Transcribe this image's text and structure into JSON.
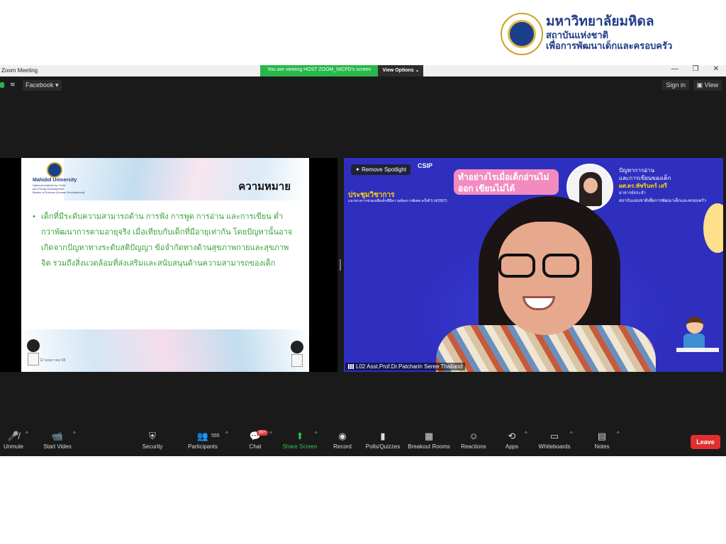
{
  "branding": {
    "org_name": "มหาวิทยาลัยมหิดล",
    "line2": "สถาบันแห่งชาติ",
    "line3": "เพื่อการพัฒนาเด็กและครอบครัว"
  },
  "window": {
    "title": "Zoom Meeting",
    "host_banner": "You are viewing HOST ZOOM_NICFD's screen",
    "view_options": "View Options",
    "controls": [
      "—",
      "❐",
      "✕"
    ]
  },
  "topbar": {
    "facebook_label": "Facebook",
    "signin_label": "Sign in",
    "view_label": "View"
  },
  "slide": {
    "university": "Mahidol University",
    "sub1": "National Institute for Child",
    "sub2": "and Family Development",
    "sub3": "Master of Science (Human Development)",
    "title": "ความหมาย",
    "bullet": "•",
    "body": "เด็กที่มีระดับความสามารถด้าน การฟัง การพูด การอ่าน และการเขียน ต่ำกว่าพัฒนาการตามอายุจริง เมื่อเทียบกับเด็กที่มีอายุเท่ากัน โดยปัญหานั้นอาจเกิดจากปัญหาทางระดับสติปัญญา ข้อจำกัดทางด้านสุขภาพกายและสุขภาพจิต รวมถึงสิ่งแวดล้อมที่ส่งเสริมและสนับสนุนด้านความสามารถของเด็ก",
    "footer": "12 พฤษภาคม 68"
  },
  "video": {
    "remove_spotlight": "Remove Spotlight",
    "csip": "CSIP",
    "conference_title": "ประชุมวิชาการ",
    "conference_sub": "แนวทางการช่วยเหลือเด็กที่มีความต้องการพิเศษ ครั้งที่ 5 (4/2567)",
    "headline": "ทำอย่างไรเมื่อเด็กอ่านไม่ออก เขียนไม่ได้",
    "right_title1": "ปัญหาการอ่าน",
    "right_title2": "และการเขียนของเด็ก",
    "speaker_name": "ผศ.ดร.พัชรินทร์ เสรี",
    "speaker_role": "อาจารย์ประจำ",
    "speaker_org": "สถาบันแห่งชาติเพื่อการพัฒนาเด็กและครอบครัว",
    "name_tag": "L02 Asst.Prof.Dr.Patcharin Seree Thailand"
  },
  "toolbar": {
    "unmute": "Unmute",
    "start_video": "Start Video",
    "security": "Security",
    "participants": "Participants",
    "participants_count": "555",
    "chat": "Chat",
    "chat_badge": "99+",
    "share_screen": "Share Screen",
    "record": "Record",
    "polls": "Polls/Quizzes",
    "breakout": "Breakout Rooms",
    "reactions": "Reactions",
    "apps": "Apps",
    "whiteboards": "Whiteboards",
    "notes": "Notes",
    "leave": "Leave"
  }
}
